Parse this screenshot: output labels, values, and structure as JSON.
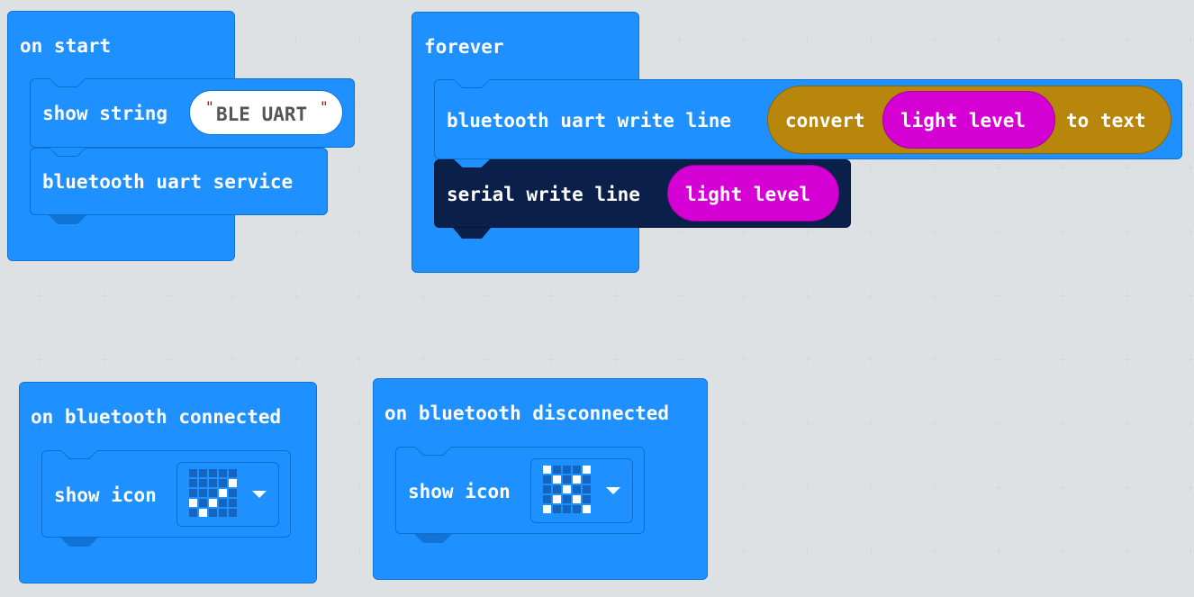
{
  "on_start": {
    "hat_label": "on start",
    "show_string_label": "show string",
    "string_value": "BLE UART",
    "bt_uart_service_label": "bluetooth uart service"
  },
  "forever": {
    "hat_label": "forever",
    "bt_write_line_label": "bluetooth uart write line",
    "convert_label": "convert",
    "light_level_label": "light level",
    "to_text_label": "to text",
    "serial_write_line_label": "serial write line",
    "serial_light_level_label": "light level"
  },
  "on_connected": {
    "hat_label": "on bluetooth connected",
    "show_icon_label": "show icon",
    "icon": "check-icon",
    "icon_pixels": [
      0,
      0,
      0,
      0,
      0,
      0,
      0,
      0,
      0,
      1,
      0,
      0,
      0,
      1,
      0,
      1,
      0,
      1,
      0,
      0,
      0,
      1,
      0,
      0,
      0
    ]
  },
  "on_disconnected": {
    "hat_label": "on bluetooth disconnected",
    "show_icon_label": "show icon",
    "icon": "x-icon",
    "icon_pixels": [
      1,
      0,
      0,
      0,
      1,
      0,
      1,
      0,
      1,
      0,
      0,
      0,
      1,
      0,
      0,
      0,
      1,
      0,
      1,
      0,
      1,
      0,
      0,
      0,
      1
    ]
  },
  "colors": {
    "basic": "#1e90ff",
    "bluetooth": "#0b1f4b",
    "text_convert": "#b8860b",
    "input": "#d400d4",
    "workspace": "#ecf0f1"
  }
}
